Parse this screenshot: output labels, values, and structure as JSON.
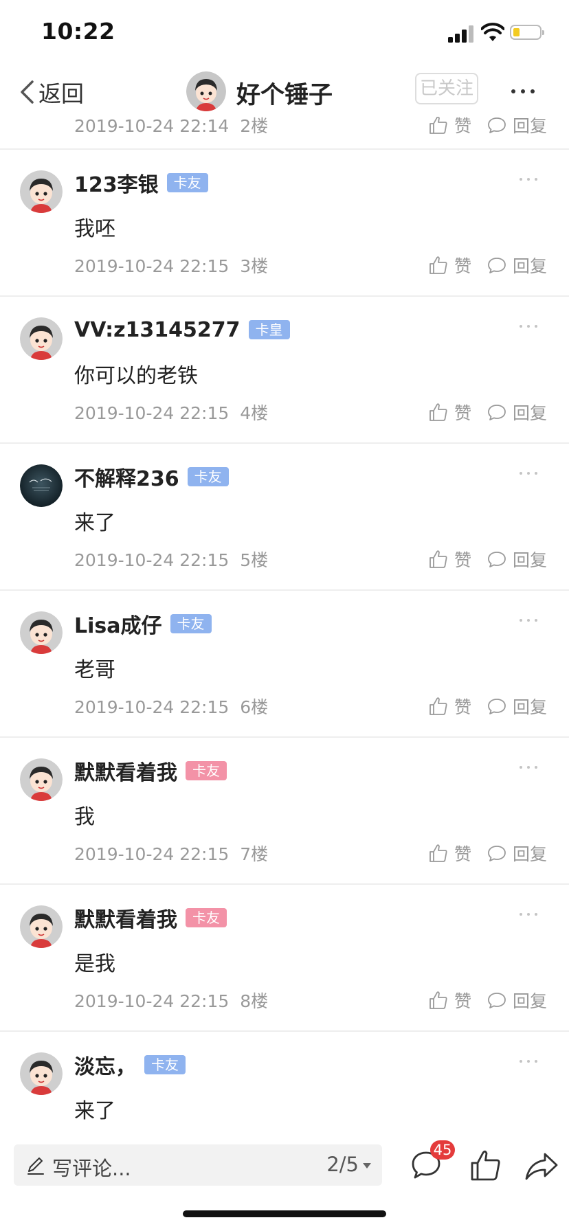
{
  "status_bar": {
    "time": "10:22"
  },
  "nav": {
    "back_label": "返回",
    "title": "好个锤子",
    "follow_label": "已关注"
  },
  "partial_row": {
    "time": "2019-10-24 22:14",
    "floor": "2楼",
    "like_label": "赞",
    "reply_label": "回复"
  },
  "actions": {
    "like_label": "赞",
    "reply_label": "回复"
  },
  "comments": [
    {
      "username": "123李银",
      "badge": "卡友",
      "badge_color": "blue",
      "content": "我呸",
      "time": "2019-10-24 22:15",
      "floor": "3楼"
    },
    {
      "username": "VV:z13145277",
      "badge": "卡皇",
      "badge_color": "blue",
      "content": "你可以的老铁",
      "time": "2019-10-24 22:15",
      "floor": "4楼"
    },
    {
      "username": "不解释236",
      "badge": "卡友",
      "badge_color": "blue",
      "content": "来了",
      "time": "2019-10-24 22:15",
      "floor": "5楼"
    },
    {
      "username": "Lisa成仔",
      "badge": "卡友",
      "badge_color": "blue",
      "content": "老哥",
      "time": "2019-10-24 22:15",
      "floor": "6楼"
    },
    {
      "username": "默默看着我",
      "badge": "卡友",
      "badge_color": "pink",
      "content": "我",
      "time": "2019-10-24 22:15",
      "floor": "7楼"
    },
    {
      "username": "默默看着我",
      "badge": "卡友",
      "badge_color": "pink",
      "content": "是我",
      "time": "2019-10-24 22:15",
      "floor": "8楼"
    },
    {
      "username": "淡忘，",
      "badge": "卡友",
      "badge_color": "blue",
      "content": "来了",
      "time": "",
      "floor": ""
    }
  ],
  "bottom_bar": {
    "placeholder": "写评论...",
    "page_indicator": "2/5",
    "comment_count": "45"
  },
  "colors": {
    "badge_blue": "#8fb3ef",
    "badge_pink": "#f392a7",
    "count_badge_red": "#e43b3b",
    "battery_yellow": "#f3cb21"
  }
}
